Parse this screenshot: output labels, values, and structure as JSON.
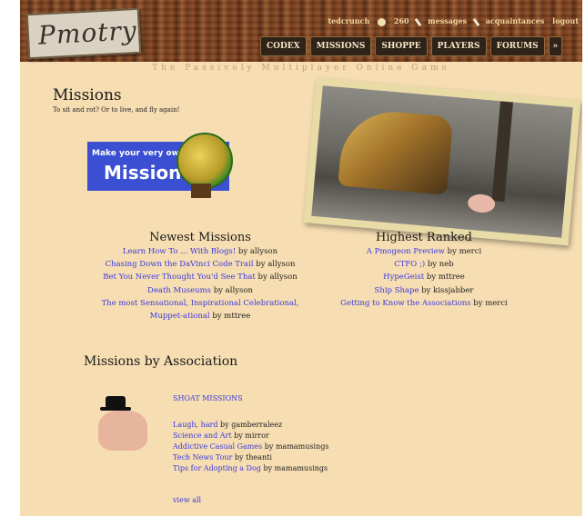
{
  "header": {
    "logo_text": "Pmotry",
    "user": {
      "name": "tedcrunch",
      "coins": "260",
      "messages_label": "messages",
      "acquaintances_label": "acquaintances",
      "logout_label": "logout"
    },
    "nav": [
      "CODEX",
      "MISSIONS",
      "SHOPPE",
      "PLAYERS",
      "FORUMS"
    ],
    "nav_more": "»",
    "tagline": "The Passively Multiplayer Online Game"
  },
  "page": {
    "title": "Missions",
    "subtitle": "To sit and rot? Or to live, and fly again!"
  },
  "banner": {
    "line1": "Make your very own",
    "line2": "Mission!"
  },
  "newest": {
    "heading": "Newest Missions",
    "items": [
      {
        "title": "Learn How To ... With Blogs!",
        "by": "by allyson"
      },
      {
        "title": "Chasing Down the DaVinci Code Trail",
        "by": "by allyson"
      },
      {
        "title": "Bet You Never Thought You'd See That",
        "by": "by allyson"
      },
      {
        "title": "Death Museums",
        "by": "by allyson"
      },
      {
        "title": "The most Sensational, Inspirational Celebrational,",
        "by": ""
      },
      {
        "title": "Muppet-ational",
        "by": "by mttree"
      }
    ]
  },
  "highest": {
    "heading": "Highest Ranked",
    "items": [
      {
        "title": "A Pmogeon Preview",
        "by": "by merci"
      },
      {
        "title": "CTFO ;)",
        "by": "by neb"
      },
      {
        "title": "HypeGeist",
        "by": "by mttree"
      },
      {
        "title": "Ship Shape",
        "by": "by kissjabber"
      },
      {
        "title": "Getting to Know the Associations",
        "by": "by merci"
      }
    ]
  },
  "associations": {
    "heading": "Missions by Association",
    "group_title": "SHOAT MISSIONS",
    "items": [
      {
        "title": "Laugh, hard",
        "by": "by gamberraleez"
      },
      {
        "title": "Science and Art",
        "by": "by mirror"
      },
      {
        "title": "Addictive Casual Games",
        "by": "by mamamusings"
      },
      {
        "title": "Tech News Tour",
        "by": "by theanti"
      },
      {
        "title": "Tips for Adopting a Dog",
        "by": "by mamamusings"
      }
    ],
    "view_all": "view all"
  }
}
